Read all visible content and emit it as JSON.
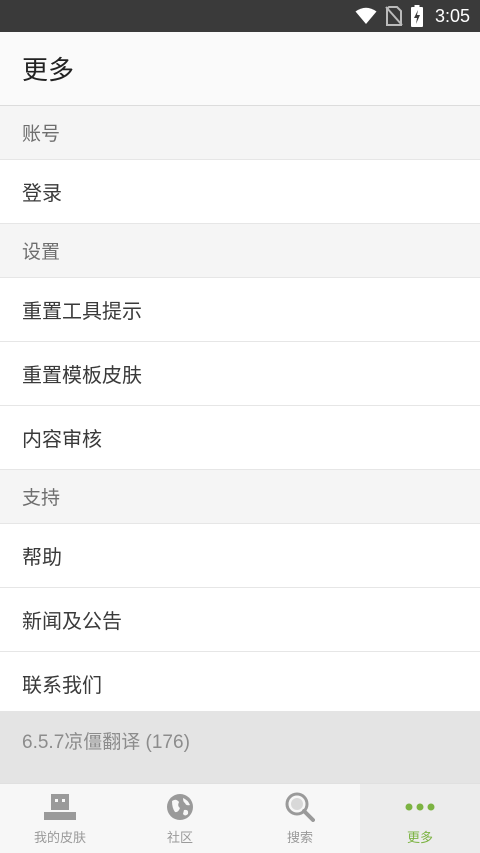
{
  "status_bar": {
    "time": "3:05",
    "icons": [
      "wifi-icon",
      "no-sim-icon",
      "battery-charging-icon"
    ]
  },
  "app_bar": {
    "title": "更多"
  },
  "sections": [
    {
      "header": "账号",
      "items": [
        "登录"
      ]
    },
    {
      "header": "设置",
      "items": [
        "重置工具提示",
        "重置模板皮肤",
        "内容审核"
      ]
    },
    {
      "header": "支持",
      "items": [
        "帮助",
        "新闻及公告",
        "联系我们"
      ]
    }
  ],
  "version_text": "6.5.7凉僵翻译 (176)",
  "bottom_nav": {
    "active": "more",
    "items": [
      {
        "id": "my-skins",
        "label": "我的皮肤",
        "icon": "robot-head-icon"
      },
      {
        "id": "community",
        "label": "社区",
        "icon": "globe-icon"
      },
      {
        "id": "search",
        "label": "搜索",
        "icon": "search-icon"
      },
      {
        "id": "more",
        "label": "更多",
        "icon": "more-dots-icon"
      }
    ]
  },
  "colors": {
    "status_bar": "#3a3a3a",
    "accent": "#7cb342",
    "inactive": "#9a9a9a"
  }
}
